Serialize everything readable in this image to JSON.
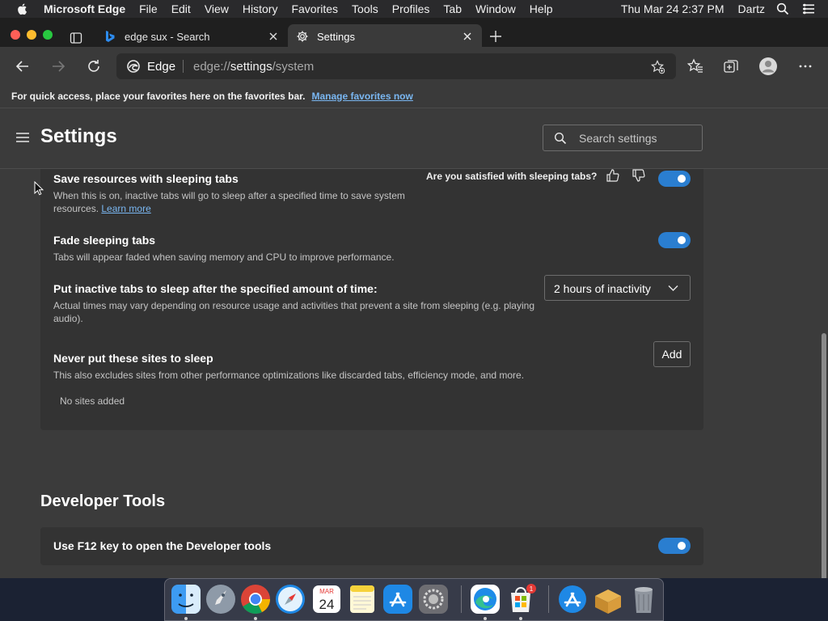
{
  "menubar": {
    "app_name": "Microsoft Edge",
    "items": [
      "File",
      "Edit",
      "View",
      "History",
      "Favorites",
      "Tools",
      "Profiles",
      "Tab",
      "Window",
      "Help"
    ],
    "clock": "Thu Mar 24  2:37 PM",
    "user": "Dartz"
  },
  "tabs": [
    {
      "title": "edge sux - Search",
      "icon": "bing-icon",
      "active": false
    },
    {
      "title": "Settings",
      "icon": "gear-icon",
      "active": true
    }
  ],
  "addressbar": {
    "brand": "Edge",
    "url_prefix": "edge://",
    "url_host": "settings",
    "url_path": "/system"
  },
  "favbar": {
    "message": "For quick access, place your favorites here on the favorites bar.",
    "link": "Manage favorites now"
  },
  "settings": {
    "title": "Settings",
    "search_placeholder": "Search settings"
  },
  "performance": {
    "feedback_question": "Are you satisfied with sleeping tabs?",
    "sleeping_tabs": {
      "title": "Save resources with sleeping tabs",
      "desc": "When this is on, inactive tabs will go to sleep after a specified time to save system resources.",
      "learn_more": "Learn more",
      "enabled": true
    },
    "fade_tabs": {
      "title": "Fade sleeping tabs",
      "desc": "Tabs will appear faded when saving memory and CPU to improve performance.",
      "enabled": true
    },
    "sleep_after": {
      "title": "Put inactive tabs to sleep after the specified amount of time:",
      "desc": "Actual times may vary depending on resource usage and activities that prevent a site from sleeping (e.g. playing audio).",
      "selected": "2 hours of inactivity"
    },
    "never_sleep": {
      "title": "Never put these sites to sleep",
      "desc": "This also excludes sites from other performance optimizations like discarded tabs, efficiency mode, and more.",
      "add_label": "Add",
      "empty_text": "No sites added"
    }
  },
  "developer": {
    "section_title": "Developer Tools",
    "f12": {
      "title": "Use F12 key to open the Developer tools",
      "enabled": true
    }
  },
  "dock": {
    "apps": [
      "finder-icon",
      "launchpad-icon",
      "chrome-icon",
      "safari-icon",
      "calendar-icon",
      "notes-icon",
      "app-store-icon",
      "system-preferences-icon",
      "edge-icon",
      "microsoft-store-icon",
      "app-store-download-icon",
      "archive-utility-icon",
      "trash-icon"
    ],
    "calendar_month": "MAR",
    "calendar_day": "24",
    "badge_count": "1"
  },
  "colors": {
    "accent": "#2a7ed0",
    "link": "#7ab7f2",
    "page_bg": "#3b3b3b",
    "card_bg": "#333333"
  }
}
